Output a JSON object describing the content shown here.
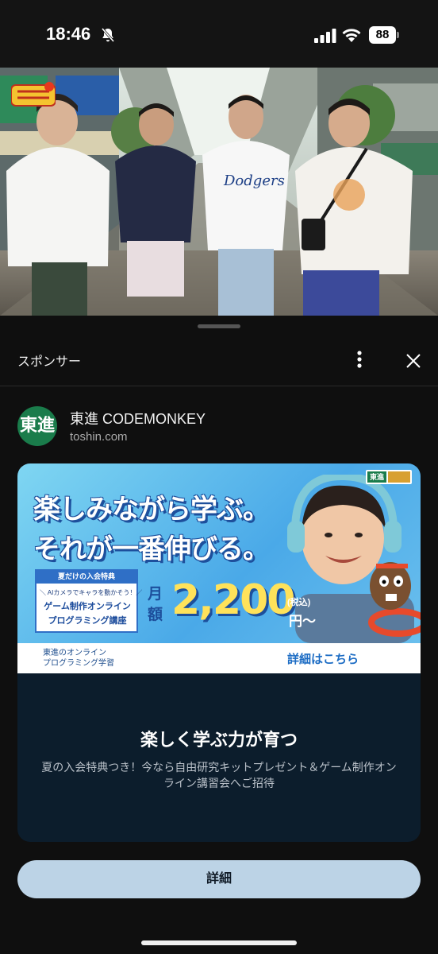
{
  "status_bar": {
    "time": "18:46",
    "battery": "88",
    "icons": [
      "bell-slash-icon",
      "cellular-signal-icon",
      "wifi-icon",
      "battery-icon"
    ]
  },
  "video": {
    "description_icon": "video-frame",
    "show_logo_text": "どれだけ!!"
  },
  "sheet": {
    "header_label": "スポンサー",
    "more_icon": "more-vertical-icon",
    "close_icon": "close-icon"
  },
  "advertiser": {
    "logo_text": "東進",
    "name": "東進 CODEMONKEY",
    "domain": "toshin.com"
  },
  "banner": {
    "headline_1": "楽しみながら学ぶ。",
    "headline_2": "それが一番伸びる。",
    "promo_tab": "夏だけの入会特典",
    "promo_sub": "＼ AIカメラでキャラを動かそう！／",
    "promo_line_1": "ゲーム制作オンライン",
    "promo_line_2": "プログラミング講座",
    "monthly_label": "月額",
    "price": "2,200",
    "tax": "(税込)",
    "yen": "円〜",
    "footer_left_1": "東進のオンライン",
    "footer_left_2": "プログラミング学習",
    "footer_right": "詳細はこちら",
    "badge_text": "東進"
  },
  "ad": {
    "title": "楽しく学ぶ力が育つ",
    "description": "夏の入会特典つき！今なら自由研究キットプレゼント＆ゲーム制作オンライン講習会へご招待"
  },
  "cta": {
    "label": "詳細"
  },
  "colors": {
    "sheet_bg": "#0f0f0f",
    "card_bg": "#0c1d2c",
    "cta_bg": "#bcd3e6",
    "brand_green": "#1a7c4b"
  }
}
